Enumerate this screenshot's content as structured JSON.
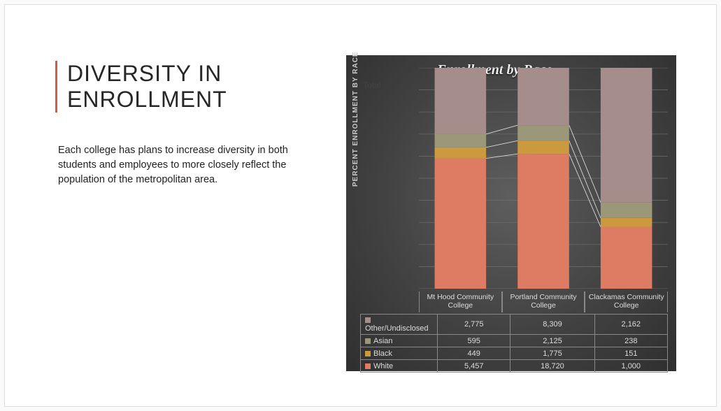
{
  "heading": "DIVERSITY IN ENROLLMENT",
  "description": "Each college has plans to increase diversity in both students and employees to more closely reflect the population of the metropolitan area.",
  "chart_data": {
    "type": "bar",
    "stacked": true,
    "title": "Enrollment by Race",
    "ylabel": "PERCENT ENROLLMENT BY RACE",
    "total_label": "Total",
    "ylim": [
      0,
      100
    ],
    "ytick_step": 10,
    "categories": [
      "Mt Hood Community College",
      "Portland Community College",
      "Clackamas Community College"
    ],
    "series": [
      {
        "name": "Other/Undisclosed",
        "color": "#a48d8b",
        "values": [
          2775,
          8309,
          2162
        ]
      },
      {
        "name": "Asian",
        "color": "#9a9878",
        "values": [
          595,
          2125,
          238
        ]
      },
      {
        "name": "Black",
        "color": "#cc9a3e",
        "values": [
          449,
          1775,
          151
        ]
      },
      {
        "name": "White",
        "color": "#de7b63",
        "values": [
          5457,
          18720,
          1000
        ]
      }
    ],
    "percent_stack": [
      {
        "category": "Mt Hood Community College",
        "White": 59,
        "Black": 5,
        "Asian": 6,
        "Other/Undisclosed": 30
      },
      {
        "category": "Portland Community College",
        "White": 61,
        "Black": 6,
        "Asian": 7,
        "Other/Undisclosed": 27
      },
      {
        "category": "Clackamas Community College",
        "White": 28,
        "Black": 4,
        "Asian": 7,
        "Other/Undisclosed": 61
      }
    ],
    "table_rows": [
      {
        "label": "Other/Undisclosed",
        "color": "#a48d8b",
        "cells": [
          "2,775",
          "8,309",
          "2,162"
        ]
      },
      {
        "label": "Asian",
        "color": "#9a9878",
        "cells": [
          "595",
          "2,125",
          "238"
        ]
      },
      {
        "label": "Black",
        "color": "#cc9a3e",
        "cells": [
          "449",
          "1,775",
          "151"
        ]
      },
      {
        "label": "White",
        "color": "#de7b63",
        "cells": [
          "5,457",
          "18,720",
          "1,000"
        ]
      }
    ]
  }
}
